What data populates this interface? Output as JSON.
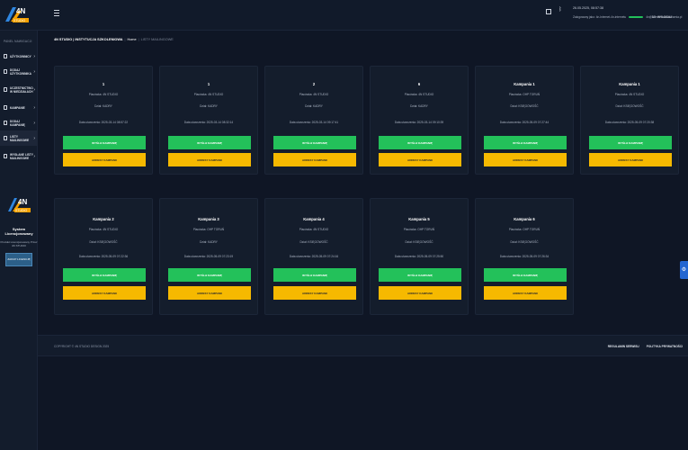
{
  "topbar": {
    "datetime": "26.05.2025, 08:57:38",
    "status_text": "Zalogowany jako: 4n-Internet-4n-internetu",
    "email": "4n@internetowakawiarnia.pl",
    "logout_label": "WYLOGUJ"
  },
  "sidebar": {
    "panel_title": "PANEL NAWIGACJI",
    "items": [
      {
        "label": "UŻYTKOWNICY"
      },
      {
        "label": "DODAJ UŻYTKOWNIKA"
      },
      {
        "label": "UCZESTNICTWO W NIEDZIAŁACH"
      },
      {
        "label": "KAMPANIE"
      },
      {
        "label": "DODAJ KAMPANIĘ"
      },
      {
        "label": "LISTY MAILINGOWE"
      },
      {
        "label": "WYSŁANE LISTY MAILINGOWE"
      }
    ],
    "promo": {
      "title": "System Licencjonowany",
      "subtitle": "Produkt Licencjonowany Przez 4N STUDIO",
      "button": "ZAKUP LICENCJĘ"
    }
  },
  "breadcrumb": {
    "org": "4N STUDIO | INSTYTUCJA SZKOLENIOWA",
    "home": "Home",
    "current": "LISTY MAILINGOWE"
  },
  "buttons": {
    "send": "WYŚLIJ KAMPANIĘ",
    "recipients": "ADRESY KAMPANII"
  },
  "cards": [
    {
      "title": "1",
      "placowka": "Placówka: 4N STUDIO",
      "dzial": "Dział: KADRY",
      "date": "Data utworzenia: 2025-03-14 08:57:22"
    },
    {
      "title": "1",
      "placowka": "Placówka: 4N STUDIO",
      "dzial": "Dział: KADRY",
      "date": "Data utworzenia: 2025-03-14 08:32:14"
    },
    {
      "title": "2",
      "placowka": "Placówka: 4N STUDIO",
      "dzial": "Dział: KADRY",
      "date": "Data utworzenia: 2025-03-14 09:17:41"
    },
    {
      "title": "6",
      "placowka": "Placówka: 4N STUDIO",
      "dzial": "Dział: KADRY",
      "date": "Data utworzenia: 2025-03-14 09:10:39"
    },
    {
      "title": "Kampania 1",
      "placowka": "Placówka: OHP TORUŃ",
      "dzial": "Dział: KSIĘGOWOŚĆ",
      "date": "Data utworzenia: 2025-05-09 07:27:44"
    },
    {
      "title": "Kampania 1",
      "placowka": "Placówka: 4N STUDIO",
      "dzial": "Dział: KSIĘGOWOŚĆ",
      "date": "Data utworzenia: 2025-05-09 07:20:38"
    },
    {
      "title": "Kampania 2",
      "placowka": "Placówka: 4N STUDIO",
      "dzial": "Dział: KSIĘGOWOŚĆ",
      "date": "Data utworzenia: 2025-05-09 07:22:36"
    },
    {
      "title": "Kampania 3",
      "placowka": "Placówka: OHP TORUŃ",
      "dzial": "Dział: KADRY",
      "date": "Data utworzenia: 2025-05-09 07:23:19"
    },
    {
      "title": "Kampania 4",
      "placowka": "Placówka: 4N STUDIO",
      "dzial": "Dział: KSIĘGOWOŚĆ",
      "date": "Data utworzenia: 2025-05-09 07:24:16"
    },
    {
      "title": "Kampania 5",
      "placowka": "Placówka: OHP TORUŃ",
      "dzial": "Dział: KSIĘGOWOŚĆ",
      "date": "Data utworzenia: 2025-05-09 07:25:50"
    },
    {
      "title": "Kampania 6",
      "placowka": "Placówka: OHP TORUŃ",
      "dzial": "Dział: KSIĘGOWOŚĆ",
      "date": "Data utworzenia: 2025-05-09 07:26:34"
    }
  ],
  "footer": {
    "copyright": "COPYRIGHT © 4N STUDIO DESIGN 2025",
    "link1": "REGULAMIN SERWISU",
    "link2": "POLITYKA PRYWATNOŚCI"
  },
  "colors": {
    "background": "#0f1625",
    "card": "#141d2c",
    "accent_green": "#23c15a",
    "accent_yellow": "#f6b900",
    "side_tab": "#2366d1"
  },
  "icons": [
    "logo-4n-studio",
    "hamburger-icon",
    "expand-icon",
    "bluetooth-icon",
    "check-icon",
    "user-icon",
    "chevron-right-icon",
    "gear-icon"
  ]
}
